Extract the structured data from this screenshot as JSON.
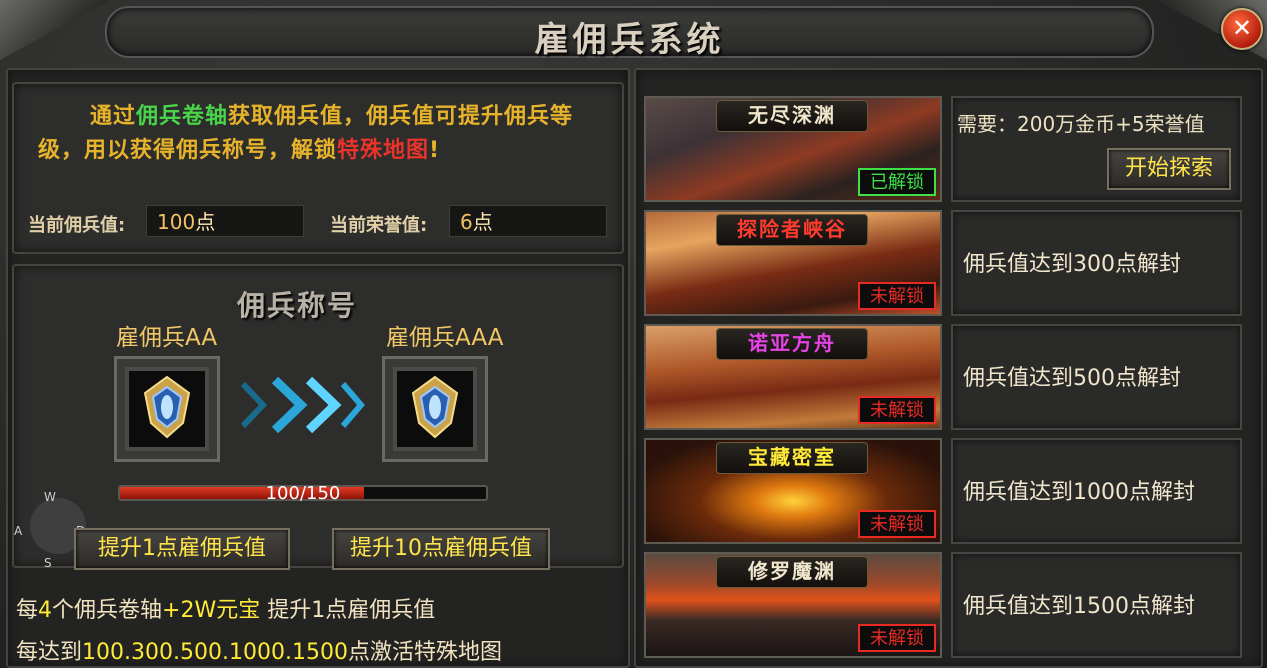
{
  "window": {
    "title": "雇佣兵系统",
    "close_icon": "close-icon"
  },
  "intro": {
    "parts": [
      {
        "text": "通过",
        "color": "#e6b32a"
      },
      {
        "text": "佣兵卷轴",
        "color": "#49d44a"
      },
      {
        "text": "获取佣兵值，佣兵值可提升佣兵等级，用以获得佣兵称号，解锁",
        "color": "#e6b32a"
      },
      {
        "text": "特殊地图",
        "color": "#e8342b"
      },
      {
        "text": "!",
        "color": "#e6b32a"
      }
    ],
    "current_merc_label": "当前佣兵值:",
    "current_merc_value": "100",
    "current_merc_unit": "点",
    "current_honor_label": "当前荣誉值:",
    "current_honor_value": "6",
    "current_honor_unit": "点"
  },
  "rank": {
    "section_title": "佣兵称号",
    "current_title": "雇佣兵AA",
    "next_title": "雇佣兵AAA",
    "badge_icon": "shield-badge-icon",
    "arrow_icon": "double-chevron-right-icon",
    "progress_text": "100/150",
    "progress_fraction": 0.667,
    "btn_up1": "提升1点雇佣兵值",
    "btn_up10": "提升10点雇佣兵值",
    "info1_parts": [
      {
        "text": "每",
        "color": "#f1e2c0"
      },
      {
        "text": "4",
        "color": "#ffea37"
      },
      {
        "text": "个佣兵卷轴",
        "color": "#f1e2c0"
      },
      {
        "text": "+2W元宝",
        "color": "#ffea37"
      },
      {
        "text": " 提升1点雇佣兵值",
        "color": "#f1e2c0"
      }
    ],
    "info2_parts": [
      {
        "text": "每达到",
        "color": "#f1e2c0"
      },
      {
        "text": "100.300.500.1000.1500",
        "color": "#ffea37"
      },
      {
        "text": "点激活特殊地图",
        "color": "#f1e2c0"
      }
    ]
  },
  "joystick": {
    "w": "W",
    "a": "A",
    "s": "S",
    "d": "D"
  },
  "maps": [
    {
      "name": "无尽深渊",
      "name_color": "#f0e6cc",
      "status": "已解锁",
      "unlocked": true,
      "need": "需要：200万金币+5荣誉值",
      "button": "开始探索",
      "bg": "linear-gradient(160deg,#5a4b48 0%,#3c3236 30%,#8e3a22 55%,#2b2220 75%,#5c2a1a 100%)"
    },
    {
      "name": "探险者峡谷",
      "name_color": "#ff3b2e",
      "status": "未解锁",
      "unlocked": false,
      "desc": "佣兵值达到300点解封",
      "bg": "linear-gradient(170deg,#b56a3a 0%,#e6a45f 25%,#7a2c14 55%,#3a1a10 80%,#c0502a 100%)"
    },
    {
      "name": "诺亚方舟",
      "name_color": "#e643e6",
      "status": "未解锁",
      "unlocked": false,
      "desc": "佣兵值达到500点解封",
      "bg": "linear-gradient(175deg,#d9a06a 0%,#b05a2a 35%,#7a2a14 60%,#c27a3a 85%,#6a3a1a 100%)"
    },
    {
      "name": "宝藏密室",
      "name_color": "#ffea37",
      "status": "未解锁",
      "unlocked": false,
      "desc": "佣兵值达到1000点解封",
      "bg": "radial-gradient(ellipse at 50% 60%,#ffd23a 0%,#e07a10 18%,#6a2a0a 45%,#2a120a 80%)"
    },
    {
      "name": "修罗魔渊",
      "name_color": "#f0e6cc",
      "status": "未解锁",
      "unlocked": false,
      "desc": "佣兵值达到1500点解封",
      "bg": "linear-gradient(180deg,#5a4a40 0%,#a04a2a 30%,#e0501a 45%,#3a2a24 65%,#1a1414 100%)"
    }
  ]
}
